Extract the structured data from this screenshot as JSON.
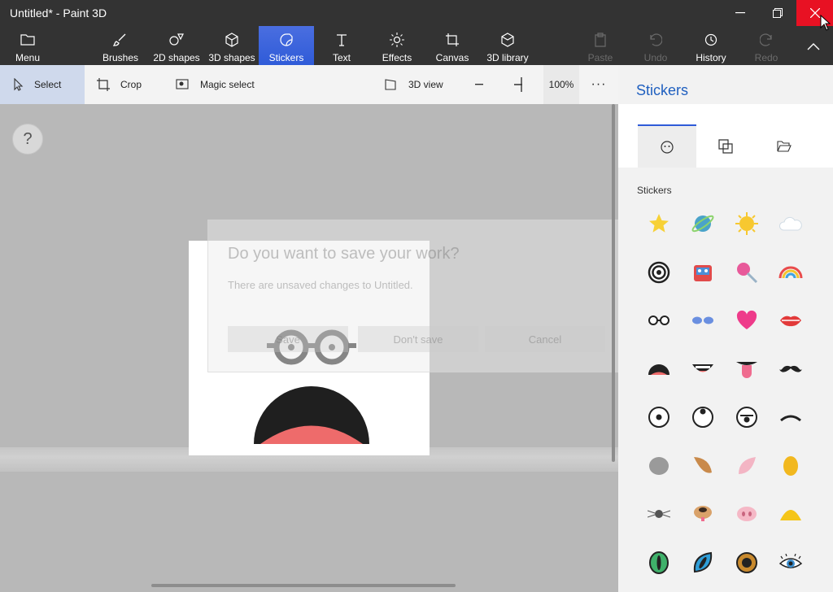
{
  "window": {
    "title": "Untitled* - Paint 3D"
  },
  "ribbon": {
    "menu": "Menu",
    "brushes": "Brushes",
    "shapes2d": "2D shapes",
    "shapes3d": "3D shapes",
    "stickers": "Stickers",
    "text": "Text",
    "effects": "Effects",
    "canvas": "Canvas",
    "library3d": "3D library",
    "paste": "Paste",
    "undo": "Undo",
    "history": "History",
    "redo": "Redo"
  },
  "toolbar": {
    "select": "Select",
    "crop": "Crop",
    "magic_select": "Magic select",
    "view3d": "3D view",
    "zoom": "100%",
    "more": "···"
  },
  "help": {
    "label": "?"
  },
  "dialog": {
    "title": "Do you want to save your work?",
    "message": "There are unsaved changes to Untitled.",
    "save": "Save",
    "dont_save": "Don't save",
    "cancel": "Cancel"
  },
  "panel": {
    "title": "Stickers",
    "section_label": "Stickers",
    "stickers": [
      "star-sticker",
      "planet-sticker",
      "sun-sticker",
      "cloud-sticker",
      "spiral-sticker",
      "robot-sticker",
      "lollipop-sticker",
      "rainbow-sticker",
      "glasses-sticker",
      "sunglasses-sticker",
      "heart-sticker",
      "lips-sticker",
      "open-mouth-sticker",
      "smile-mouth-sticker",
      "tongue-sticker",
      "mustache-sticker",
      "eye-sticker",
      "eye-up-sticker",
      "eye-down-sticker",
      "eyebrow-sticker",
      "gray-ear-sticker",
      "brown-ear-sticker",
      "pink-ear-sticker",
      "yellow-ear-sticker",
      "mouse-nose-sticker",
      "dog-nose-sticker",
      "pig-nose-sticker",
      "duck-beak-sticker",
      "green-cat-eye-sticker",
      "blue-cat-eye-sticker",
      "brown-eye-sticker",
      "lashes-eye-sticker"
    ]
  },
  "colors": {
    "accent": "#2f5bd8",
    "close": "#e81123",
    "ribbon_bg": "#333333",
    "panel_title": "#1f5fbf"
  }
}
